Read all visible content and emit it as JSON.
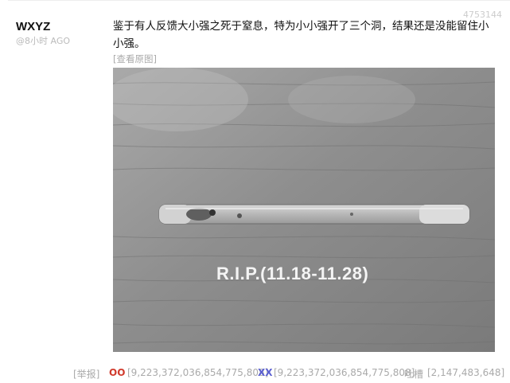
{
  "comment": {
    "author": "WXYZ",
    "time": "@8小时 AGO",
    "id": "4753144",
    "text": "鉴于有人反馈大小强之死于窒息，特为小小强开了三个洞，结果还是没能留住小小强。",
    "view_original": "[查看原图]"
  },
  "photo": {
    "overlay_text": "R.I.P.(11.18-11.28)"
  },
  "footer": {
    "report": "[举报]",
    "oo_label": "OO",
    "oo_count": "[9,223,372,036,854,775,808]",
    "xx_label": "XX",
    "xx_count": "[9,223,372,036,854,775,808]",
    "tucao_label": "吐槽",
    "tucao_count": "[2,147,483,648]"
  },
  "colors": {
    "oo": "#d03a2c",
    "xx": "#5a5fd1",
    "muted": "#aaaaaa"
  }
}
